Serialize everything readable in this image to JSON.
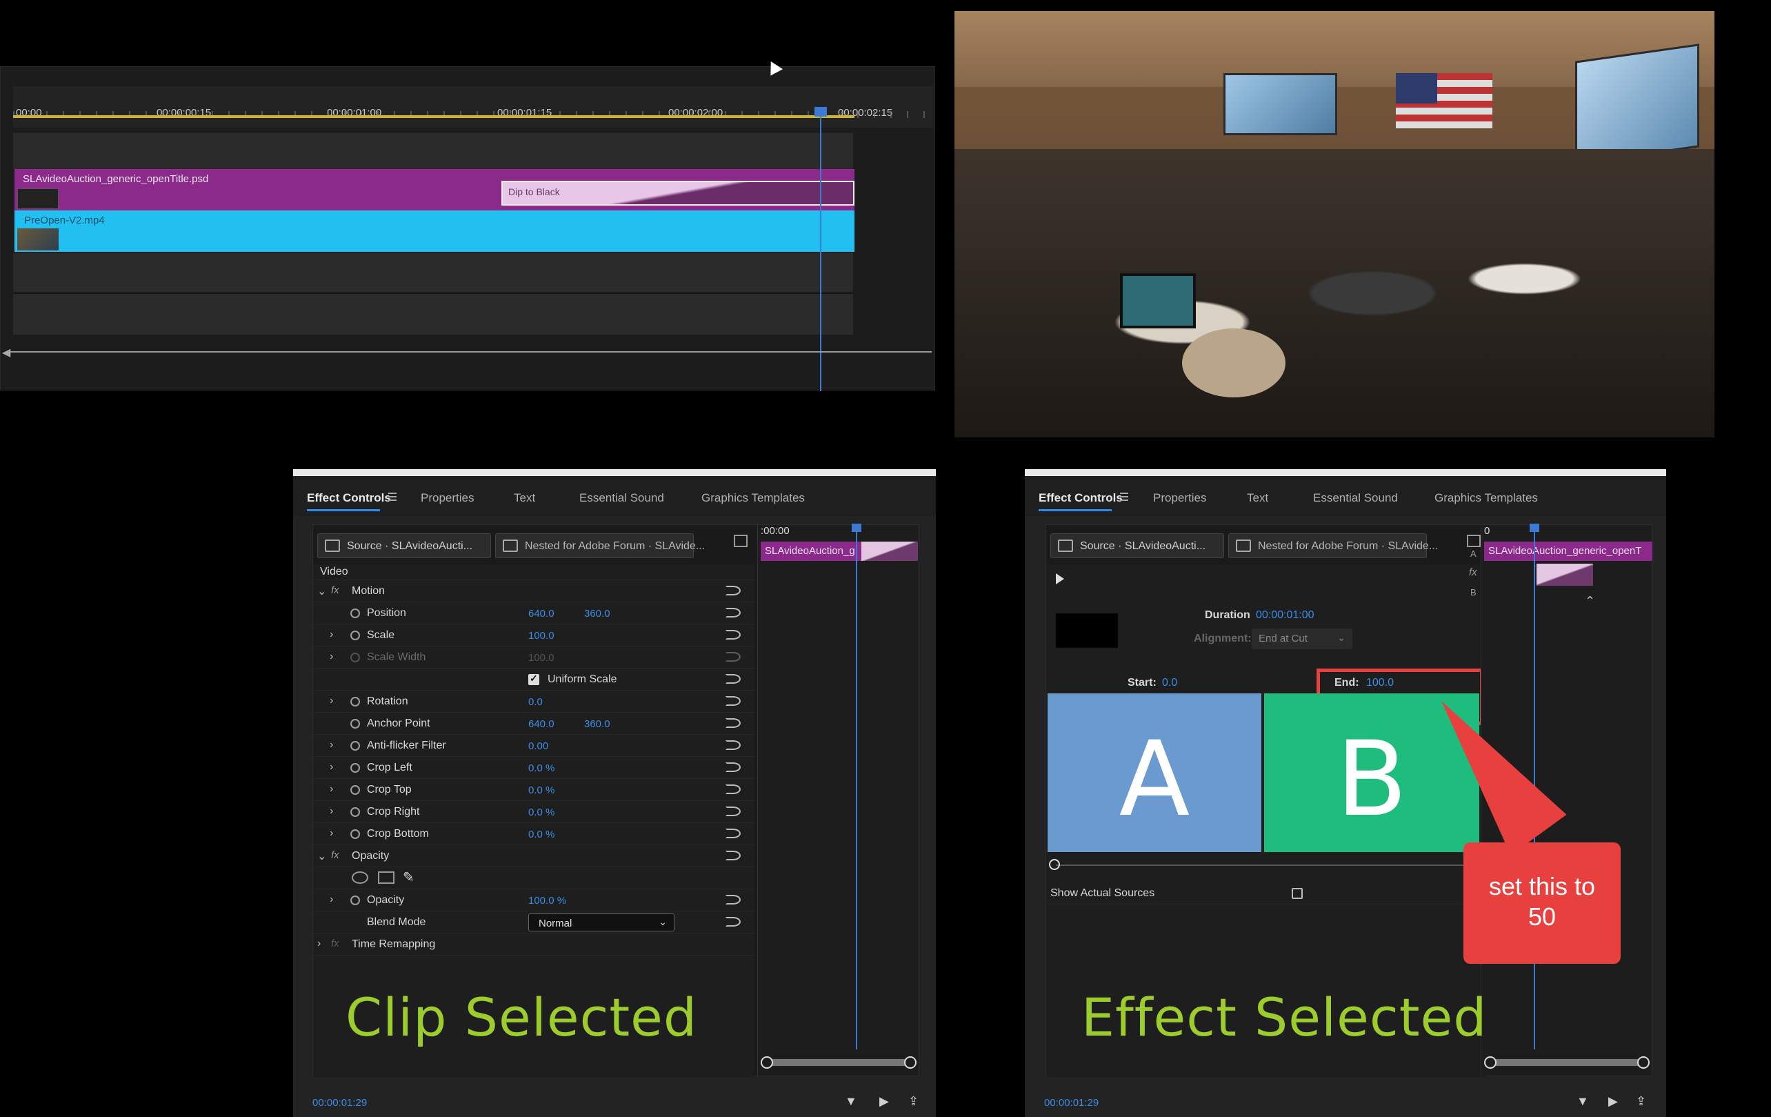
{
  "timeline": {
    "ruler_ticks": [
      "00:00",
      "00:00:00:15",
      "00:00:01:00",
      "00:00:01:15",
      "00:00:02:00",
      "00:00:02:15"
    ],
    "clip_title": "SLAvideoAuction_generic_openTitle.psd",
    "transition_label": "Dip to Black",
    "clip_video": "PreOpen-V2.mp4"
  },
  "left_panel": {
    "tabs": [
      "Effect Controls",
      "Properties",
      "Text",
      "Essential Sound",
      "Graphics Templates"
    ],
    "source_tab": "Source · SLAvideoAucti...",
    "nested_tab": "Nested for Adobe Forum · SLAvide...",
    "section_video": "Video",
    "motion": "Motion",
    "position": {
      "label": "Position",
      "x": "640.0",
      "y": "360.0"
    },
    "scale": {
      "label": "Scale",
      "value": "100.0"
    },
    "scale_width": {
      "label": "Scale Width",
      "value": "100.0"
    },
    "uniform_scale": "Uniform Scale",
    "rotation": {
      "label": "Rotation",
      "value": "0.0"
    },
    "anchor_point": {
      "label": "Anchor Point",
      "x": "640.0",
      "y": "360.0"
    },
    "anti_flicker": {
      "label": "Anti-flicker Filter",
      "value": "0.00"
    },
    "crop_left": {
      "label": "Crop Left",
      "value": "0.0 %"
    },
    "crop_top": {
      "label": "Crop Top",
      "value": "0.0 %"
    },
    "crop_right": {
      "label": "Crop Right",
      "value": "0.0 %"
    },
    "crop_bottom": {
      "label": "Crop Bottom",
      "value": "0.0 %"
    },
    "opacity_section": "Opacity",
    "opacity": {
      "label": "Opacity",
      "value": "100.0 %"
    },
    "blend_mode": {
      "label": "Blend Mode",
      "value": "Normal"
    },
    "time_remapping": "Time Remapping",
    "mini_time": ":00:00",
    "mini_clip": "SLAvideoAuction_g",
    "big_label": "Clip Selected",
    "timecode": "00:00:01:29"
  },
  "right_panel": {
    "tabs": [
      "Effect Controls",
      "Properties",
      "Text",
      "Essential Sound",
      "Graphics Templates"
    ],
    "source_tab": "Source · SLAvideoAucti...",
    "nested_tab": "Nested for Adobe Forum · SLAvide...",
    "duration_label": "Duration",
    "duration_value": "00:00:01:00",
    "alignment_label": "Alignment:",
    "alignment_value": "End at Cut",
    "start_label": "Start:",
    "start_value": "0.0",
    "end_label": "End:",
    "end_value": "100.0",
    "letter_a": "A",
    "letter_b": "B",
    "show_actual_sources": "Show Actual Sources",
    "mini_time": "0",
    "mini_clip": "SLAvideoAuction_generic_openT",
    "big_label": "Effect Selected",
    "timecode": "00:00:01:29",
    "side_letters": [
      "A",
      "fx",
      "B"
    ]
  },
  "callout": {
    "text": "set this to\n50"
  },
  "colors": {
    "accent": "#3a8de8",
    "label_green": "#9ccd2d",
    "callout_red": "#e8403f",
    "title_clip": "#8c2a8c",
    "video_clip": "#22c0f0"
  }
}
